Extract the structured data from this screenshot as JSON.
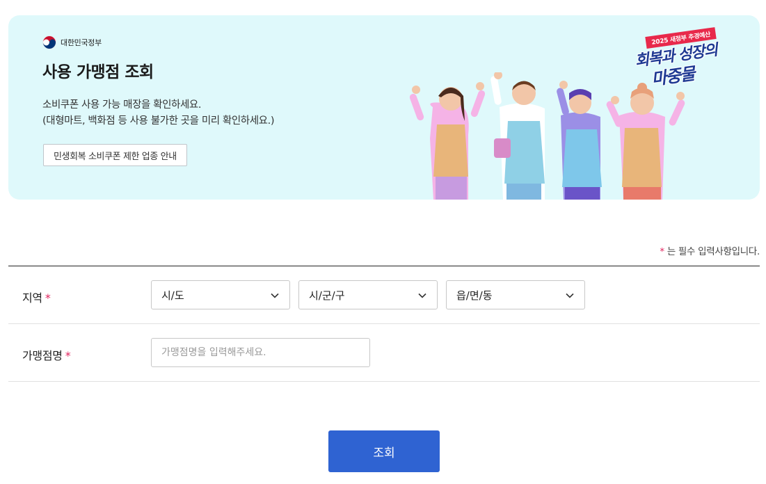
{
  "banner": {
    "gov_name": "대한민국정부",
    "title": "사용 가맹점 조회",
    "desc_line1": "소비쿠폰 사용 가능 매장을 확인하세요.",
    "desc_line2": "(대형마트, 백화점 등 사용 불가한 곳을 미리 확인하세요.)",
    "guide_button": "민생회복 소비쿠폰 제한 업종 안내",
    "background_color": "#dff9fb",
    "promo": {
      "tag": "2025 새정부 추경예산",
      "line1": "회복과 성장의",
      "line2": "마중물"
    }
  },
  "form": {
    "required_star": "*",
    "required_note": "는 필수 입력사항입니다.",
    "region_label": "지역",
    "region_selects": [
      {
        "value": "시/도",
        "chevron_icon": "chevron-down-icon"
      },
      {
        "value": "시/군/구",
        "chevron_icon": "chevron-down-icon"
      },
      {
        "value": "읍/면/동",
        "chevron_icon": "chevron-down-icon"
      }
    ],
    "name_label": "가맹점명",
    "name_placeholder": "가맹점명을 입력해주세요.",
    "name_value": ""
  },
  "submit_label": "조회",
  "colors": {
    "accent": "#2f63d2",
    "required": "#e0245e",
    "banner_bg": "#dff9fb"
  }
}
